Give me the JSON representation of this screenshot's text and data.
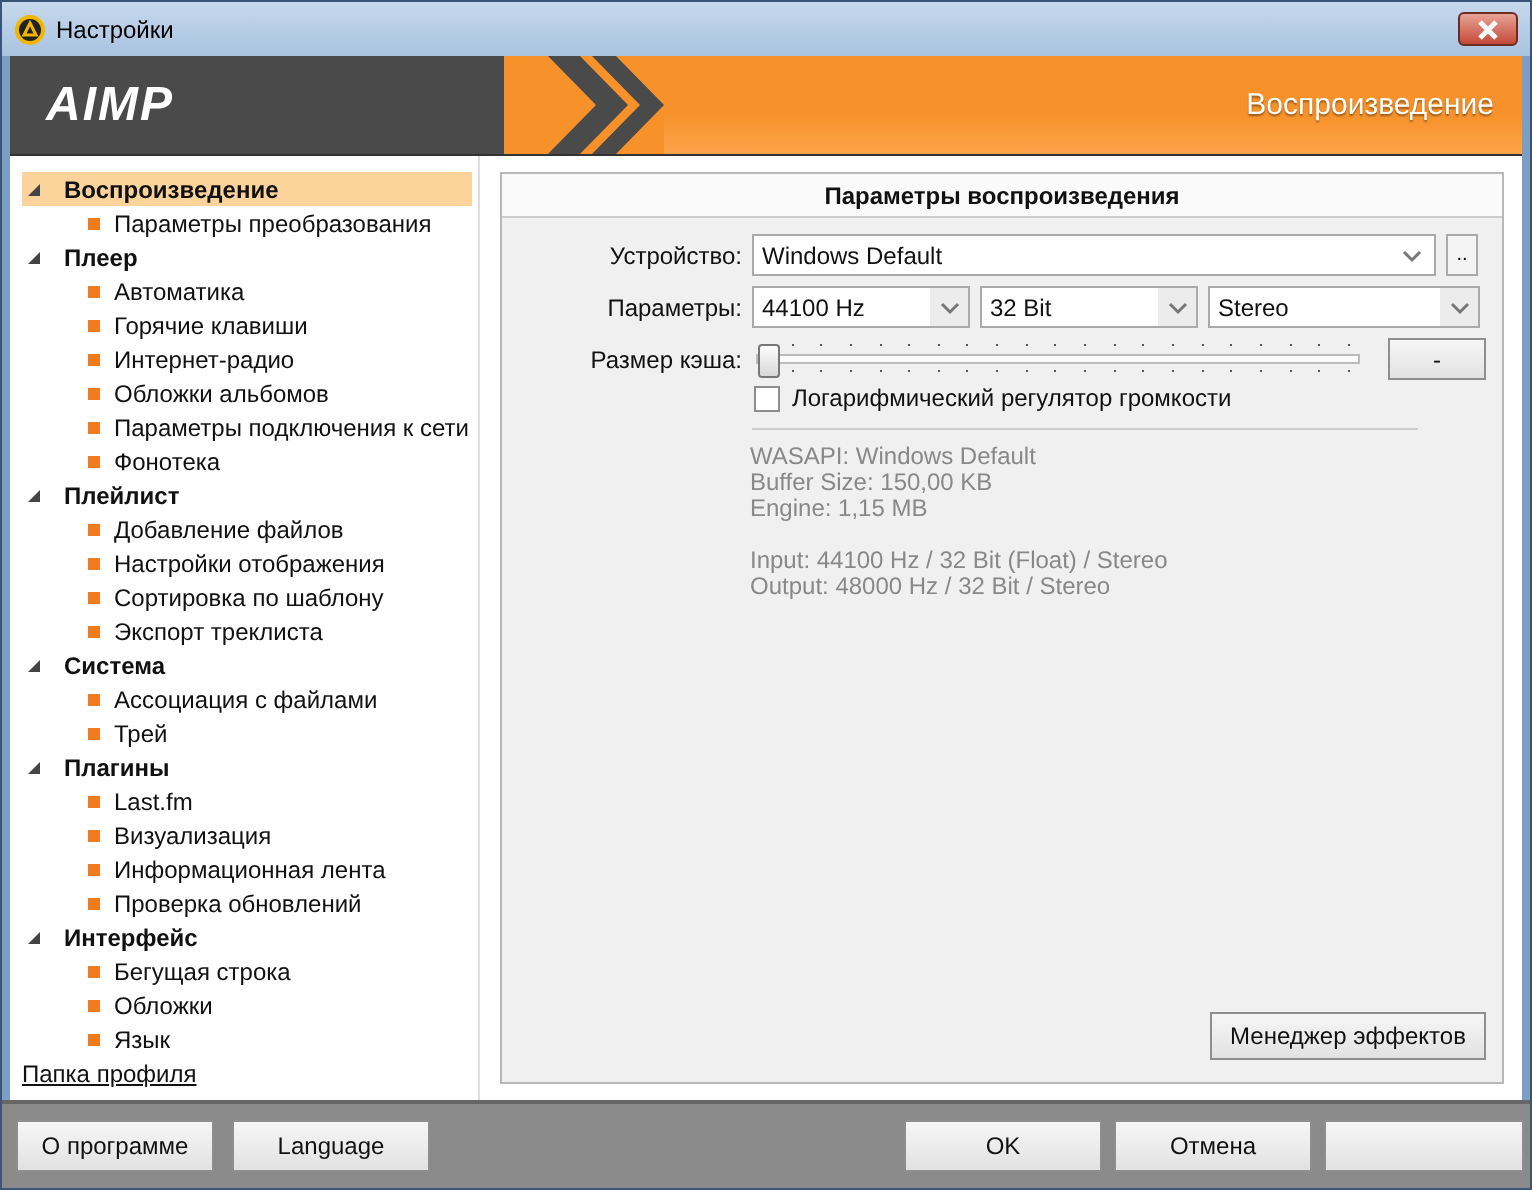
{
  "window": {
    "title": "Настройки"
  },
  "header": {
    "logo": "AIMP",
    "section": "Воспроизведение"
  },
  "tree": [
    {
      "label": "Воспроизведение",
      "selected": true,
      "expanded": true,
      "children": [
        {
          "label": "Параметры преобразования",
          "selected": false
        }
      ]
    },
    {
      "label": "Плеер",
      "selected": false,
      "expanded": true,
      "children": [
        {
          "label": "Автоматика",
          "selected": false
        },
        {
          "label": "Горячие клавиши",
          "selected": false
        },
        {
          "label": "Интернет-радио",
          "selected": false
        },
        {
          "label": "Обложки альбомов",
          "selected": false
        },
        {
          "label": "Параметры подключения к сети",
          "selected": false
        },
        {
          "label": "Фонотека",
          "selected": false
        }
      ]
    },
    {
      "label": "Плейлист",
      "selected": false,
      "expanded": true,
      "children": [
        {
          "label": "Добавление файлов",
          "selected": false
        },
        {
          "label": "Настройки отображения",
          "selected": false
        },
        {
          "label": "Сортировка по шаблону",
          "selected": false
        },
        {
          "label": "Экспорт треклиста",
          "selected": false
        }
      ]
    },
    {
      "label": "Система",
      "selected": false,
      "expanded": true,
      "children": [
        {
          "label": "Ассоциация с файлами",
          "selected": false
        },
        {
          "label": "Трей",
          "selected": false
        }
      ]
    },
    {
      "label": "Плагины",
      "selected": false,
      "expanded": true,
      "children": [
        {
          "label": "Last.fm",
          "selected": false
        },
        {
          "label": "Визуализация",
          "selected": false
        },
        {
          "label": "Информационная лента",
          "selected": false
        },
        {
          "label": "Проверка обновлений",
          "selected": false
        }
      ]
    },
    {
      "label": "Интерфейс",
      "selected": false,
      "expanded": true,
      "children": [
        {
          "label": "Бегущая строка",
          "selected": false
        },
        {
          "label": "Обложки",
          "selected": false
        },
        {
          "label": "Язык",
          "selected": false
        }
      ]
    }
  ],
  "profile_link": "Папка профиля",
  "panel": {
    "title": "Параметры воспроизведения",
    "device": {
      "label": "Устройство:",
      "value": "Windows Default",
      "more": ".."
    },
    "params": {
      "label": "Параметры:",
      "selects": [
        "44100 Hz",
        "32 Bit",
        "Stereo"
      ]
    },
    "cache": {
      "label": "Размер кэша:",
      "level": 0,
      "button": "-"
    },
    "checkbox": {
      "label": "Логарифмический регулятор громкости",
      "checked": false
    },
    "info_groups": [
      [
        "WASAPI: Windows Default",
        "Buffer Size: 150,00 KB",
        "Engine: 1,15 MB"
      ],
      [
        "Input: 44100 Hz / 32 Bit (Float) / Stereo",
        "Output: 48000 Hz / 32 Bit / Stereo"
      ]
    ],
    "effects_button": "Менеджер эффектов"
  },
  "footer": {
    "left_buttons": [
      "О программе",
      "Language"
    ],
    "right_buttons": [
      "OK",
      "Отмена"
    ]
  }
}
